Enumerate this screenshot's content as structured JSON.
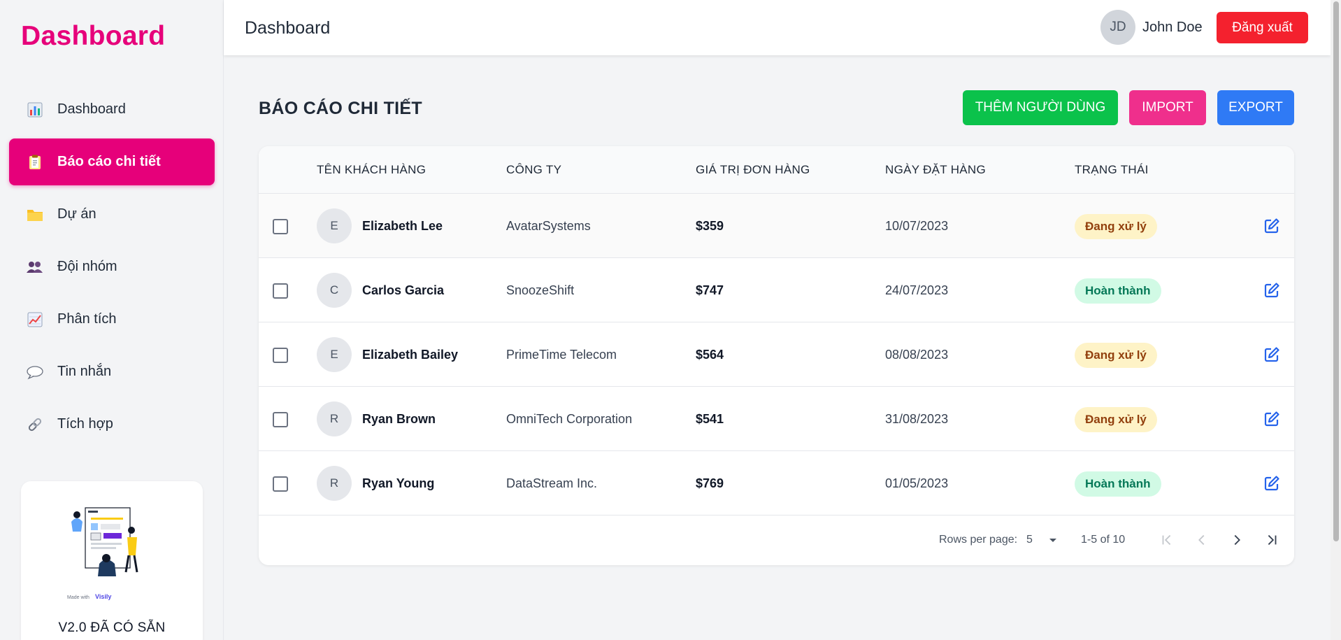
{
  "brand": "Dashboard",
  "sidebar": {
    "items": [
      {
        "label": "Dashboard",
        "icon": "bar-chart-icon",
        "active": false
      },
      {
        "label": "Báo cáo chi tiết",
        "icon": "clipboard-icon",
        "active": true
      },
      {
        "label": "Dự án",
        "icon": "folder-icon",
        "active": false
      },
      {
        "label": "Đội nhóm",
        "icon": "people-icon",
        "active": false
      },
      {
        "label": "Phân tích",
        "icon": "chart-trend-icon",
        "active": false
      },
      {
        "label": "Tin nhắn",
        "icon": "speech-bubble-icon",
        "active": false
      },
      {
        "label": "Tích hợp",
        "icon": "link-icon",
        "active": false
      }
    ],
    "promo": {
      "made_with": "Made with",
      "brand_mark": "Visily",
      "title": "V2.0 ĐÃ CÓ SẴN"
    }
  },
  "header": {
    "title": "Dashboard",
    "user": {
      "initials": "JD",
      "name": "John Doe"
    },
    "logout_label": "Đăng xuất"
  },
  "main": {
    "title": "BÁO CÁO CHI TIẾT",
    "buttons": {
      "add_user": "THÊM NGƯỜI DÙNG",
      "import": "IMPORT",
      "export": "EXPORT"
    },
    "colors": {
      "add": "#0bc24b",
      "import": "#ef2f8c",
      "export": "#2f7af5",
      "brand": "#e6007a",
      "logout": "#f4212e"
    },
    "table": {
      "columns": [
        "TÊN KHÁCH HÀNG",
        "CÔNG TY",
        "GIÁ TRỊ ĐƠN HÀNG",
        "NGÀY ĐẶT HÀNG",
        "TRẠNG THÁI"
      ],
      "rows": [
        {
          "initial": "E",
          "name": "Elizabeth Lee",
          "company": "AvatarSystems",
          "value": "$359",
          "date": "10/07/2023",
          "status": "Đang xử lý",
          "status_type": "pending"
        },
        {
          "initial": "C",
          "name": "Carlos Garcia",
          "company": "SnoozeShift",
          "value": "$747",
          "date": "24/07/2023",
          "status": "Hoàn thành",
          "status_type": "done"
        },
        {
          "initial": "E",
          "name": "Elizabeth Bailey",
          "company": "PrimeTime Telecom",
          "value": "$564",
          "date": "08/08/2023",
          "status": "Đang xử lý",
          "status_type": "pending"
        },
        {
          "initial": "R",
          "name": "Ryan Brown",
          "company": "OmniTech Corporation",
          "value": "$541",
          "date": "31/08/2023",
          "status": "Đang xử lý",
          "status_type": "pending"
        },
        {
          "initial": "R",
          "name": "Ryan Young",
          "company": "DataStream Inc.",
          "value": "$769",
          "date": "01/05/2023",
          "status": "Hoàn thành",
          "status_type": "done"
        }
      ]
    },
    "pagination": {
      "rows_per_page_label": "Rows per page:",
      "rows_per_page": "5",
      "range": "1-5 of 10"
    }
  }
}
